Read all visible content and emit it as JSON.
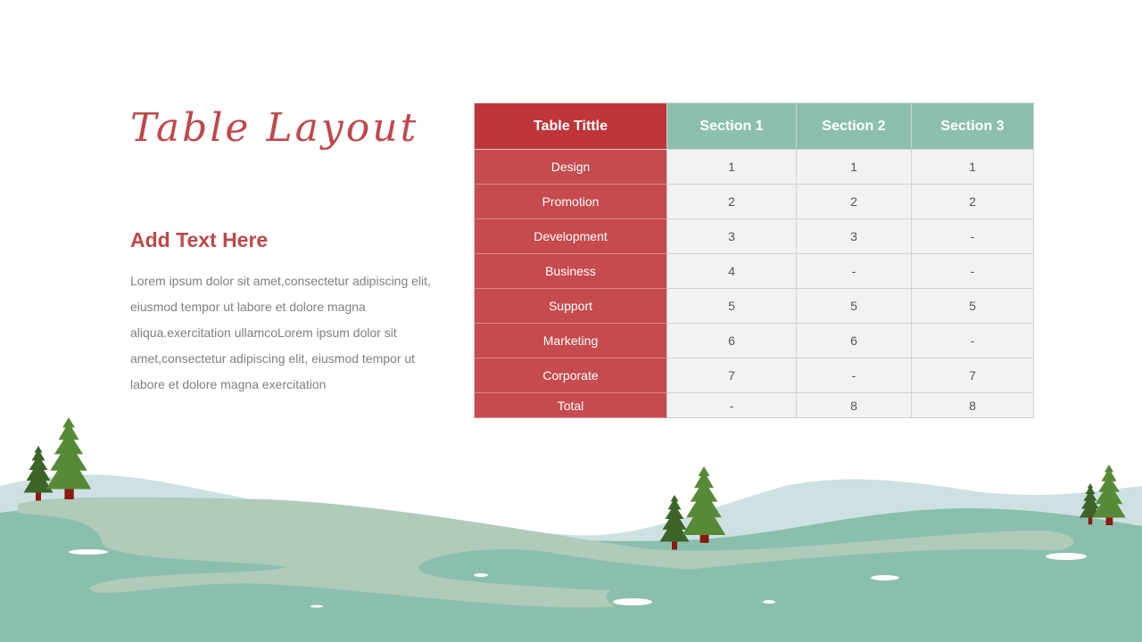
{
  "slide": {
    "title": "Table Layout",
    "subtitle": "Add Text Here",
    "body": "Lorem ipsum dolor sit amet,consectetur adipiscing elit, eiusmod tempor ut labore et dolore magna aliqua.exercitation ullamcoLorem ipsum dolor sit amet,consectetur adipiscing elit, eiusmod tempor ut labore et dolore magna exercitation"
  },
  "table": {
    "headers": [
      "Table Tittle",
      "Section 1",
      "Section 2",
      "Section 3"
    ],
    "rows": [
      {
        "label": "Design",
        "values": [
          "1",
          "1",
          "1"
        ]
      },
      {
        "label": "Promotion",
        "values": [
          "2",
          "2",
          "2"
        ]
      },
      {
        "label": "Development",
        "values": [
          "3",
          "3",
          "-"
        ]
      },
      {
        "label": "Business",
        "values": [
          "4",
          "-",
          "-"
        ]
      },
      {
        "label": "Support",
        "values": [
          "5",
          "5",
          "5"
        ]
      },
      {
        "label": "Marketing",
        "values": [
          "6",
          "6",
          "-"
        ]
      },
      {
        "label": "Corporate",
        "values": [
          "7",
          "-",
          "7"
        ]
      },
      {
        "label": "Total",
        "values": [
          "-",
          "8",
          "8"
        ]
      }
    ]
  },
  "colors": {
    "accent_red": "#c0474a",
    "header_red": "#c0353a",
    "row_label_red": "#c54b4e",
    "header_green": "#8cbfae",
    "cell_bg": "#f2f2f2",
    "body_text": "#7f7f7f"
  },
  "decorations": {
    "scene": "winter-landscape-with-pine-trees"
  }
}
